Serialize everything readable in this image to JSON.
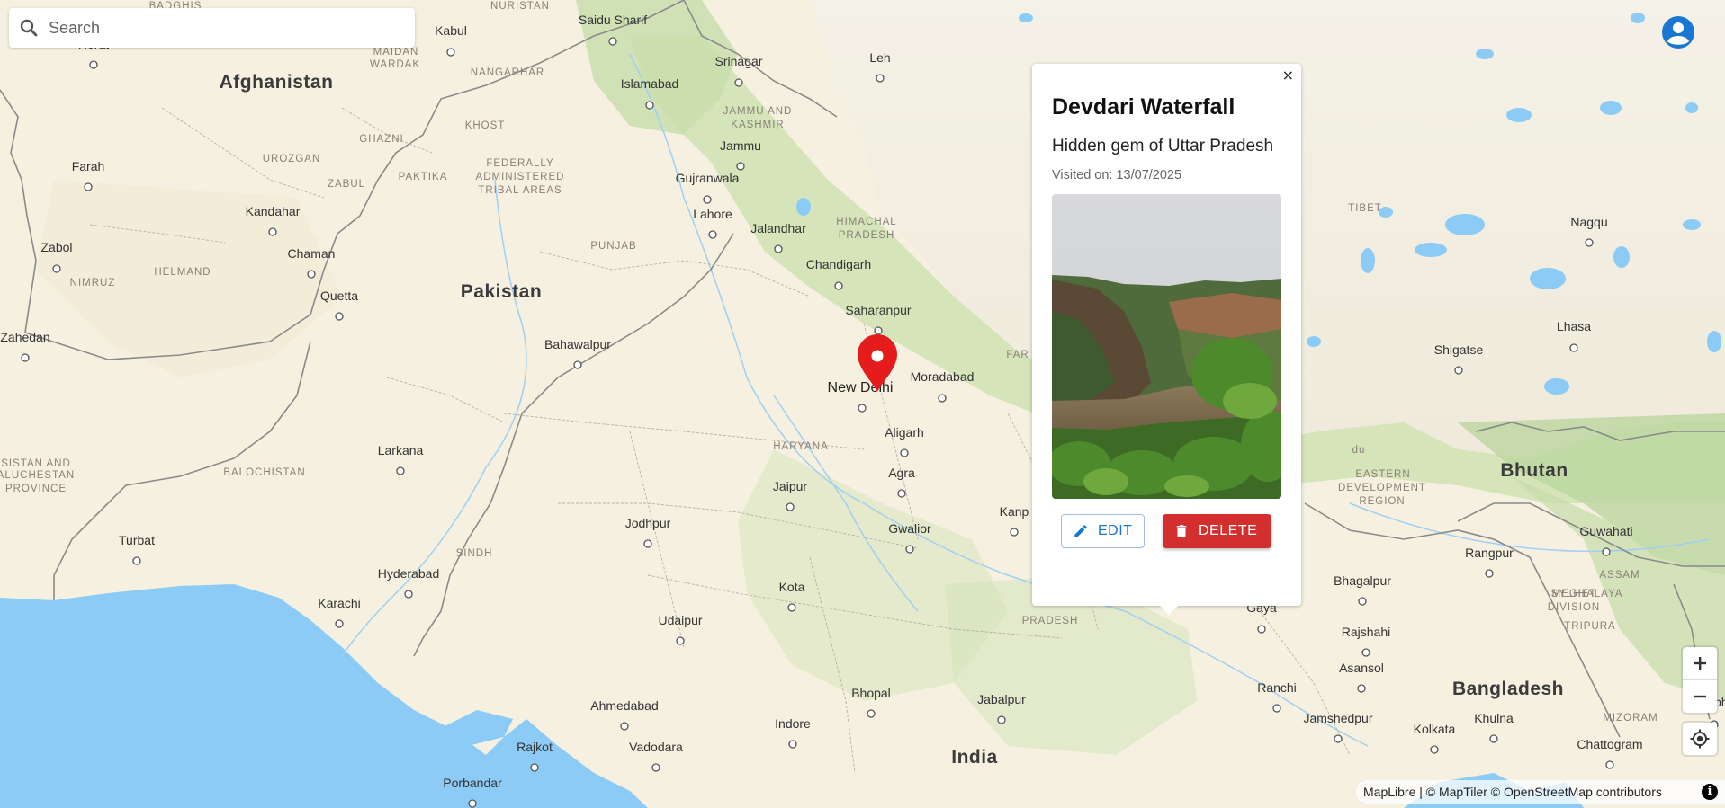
{
  "search": {
    "placeholder": "Search"
  },
  "map": {
    "countries": [
      "Afghanistan",
      "Pakistan",
      "India",
      "Bhutan",
      "Bangladesh"
    ],
    "cities": [
      "Herat",
      "Kabul",
      "Saidu Sharif",
      "Srinagar",
      "Leh",
      "Islamabad",
      "Farah",
      "Kandahar",
      "Jammu",
      "Gujranwala",
      "Lahore",
      "Jalandhar",
      "Chandigarh",
      "Zabol",
      "Chaman",
      "Quetta",
      "Saharanpur",
      "Moradabad",
      "New Delhi",
      "Aligarh",
      "Agra",
      "Bahawalpur",
      "Zahedan",
      "Larkana",
      "Jaipur",
      "Gwalior",
      "Jodhpur",
      "Kanp",
      "Turbat",
      "Hyderabad",
      "Karachi",
      "Kota",
      "Udaipur",
      "Bhopal",
      "Jabalpur",
      "Ahmedabad",
      "Indore",
      "Rajkot",
      "Vadodara",
      "Porbandar",
      "Nagqu",
      "Lhasa",
      "Shigatse",
      "Guwahati",
      "Rangpur",
      "Bhagalpur",
      "Gaya",
      "Rajshahi",
      "Asansol",
      "Ranchi",
      "Jamshedpur",
      "Kolkata",
      "Khulna",
      "Chattogram",
      "Imph"
    ],
    "regions": [
      "BADGHIS",
      "NURISTAN",
      "MAIDAN",
      "WARDAK",
      "NANGARHAR",
      "KHOST",
      "GHAZNI",
      "UROZGAN",
      "ZABUL",
      "PAKTIKA",
      "FEDERALLY",
      "ADMINISTERED",
      "TRIBAL AREAS",
      "HELMAND",
      "NIMRUZ",
      "JAMMU AND",
      "KASHMIR",
      "HIMACHAL",
      "PRADESH",
      "PUNJAB",
      "HARYANA",
      "BALOCHISTAN",
      "SINDH",
      "SISTAN AND",
      "ALUCHESTAN",
      "PROVINCE",
      "TIBET",
      "EASTERN",
      "DEVELOPMENT",
      "REGION",
      "ASSAM",
      "MEGHALAYA",
      "SYLHET",
      "DIVISION",
      "TRIPURA",
      "MIZORAM",
      "PRADESH",
      "du",
      "FAR"
    ]
  },
  "popup": {
    "close": "×",
    "title": "Devdari Waterfall",
    "description": "Hidden gem of Uttar Pradesh",
    "visited": "Visited on: 13/07/2025",
    "edit_label": "EDIT",
    "delete_label": "DELETE"
  },
  "controls": {
    "zoom_in": "+",
    "zoom_out": "−"
  },
  "attribution": {
    "text": "MapLibre | © MapTiler © OpenStreetMap contributors",
    "info": "i"
  },
  "colors": {
    "land": "#f5f0df",
    "water": "#8ccbf5",
    "forest": "#bfd9a3",
    "marker": "#e51c1c",
    "delete": "#d32f2f",
    "edit": "#1976d2"
  }
}
